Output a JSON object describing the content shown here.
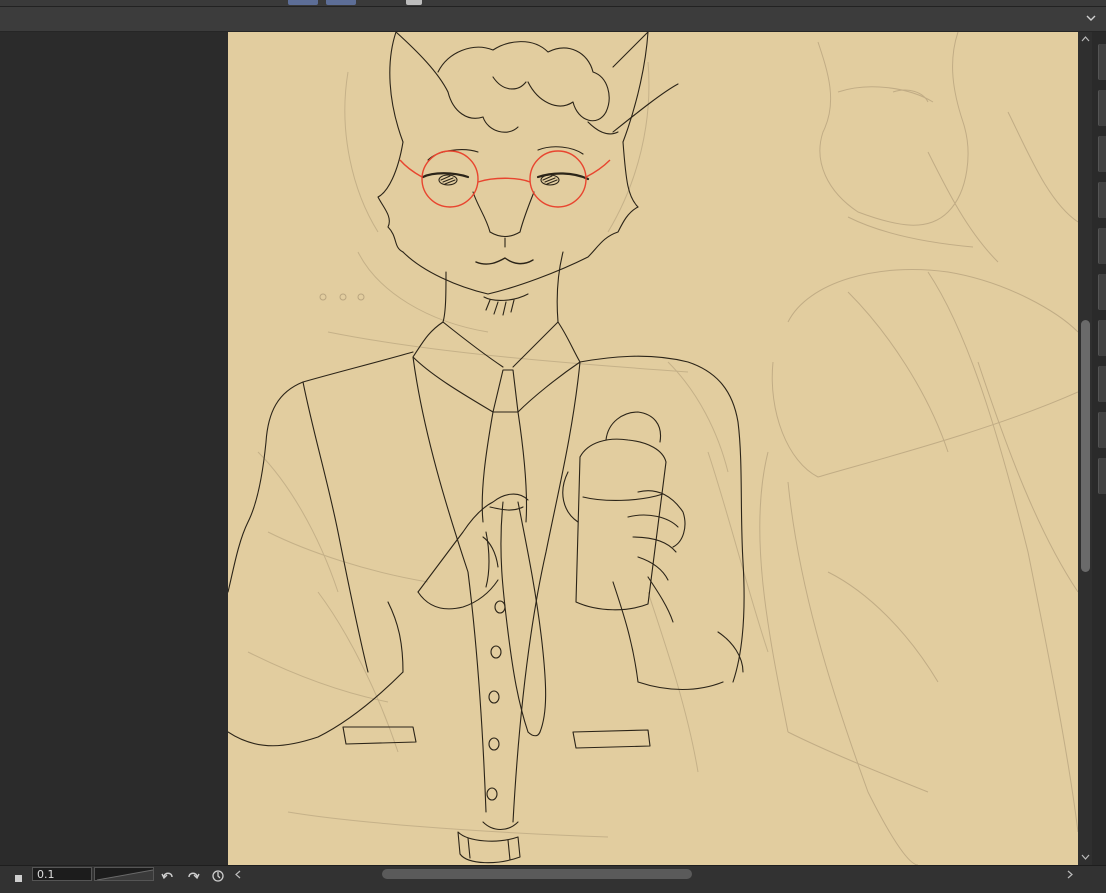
{
  "toolbar": {
    "expand_icon": "chevron-down-icon"
  },
  "status": {
    "zoom_value": "0.1",
    "stop_icon": "stop-icon",
    "undo_icon": "undo-icon",
    "redo_icon": "redo-icon",
    "reset_icon": "rotate-reset-icon"
  },
  "colors": {
    "canvas_bg": "#e2cd9f",
    "line_art": "#2b2418",
    "sketch": "#b9a57f",
    "glasses": "#e8452f",
    "ui_dark": "#2b2b2b"
  },
  "scrollbars": {
    "vertical_position": 0.45,
    "horizontal_position": 0.27
  }
}
